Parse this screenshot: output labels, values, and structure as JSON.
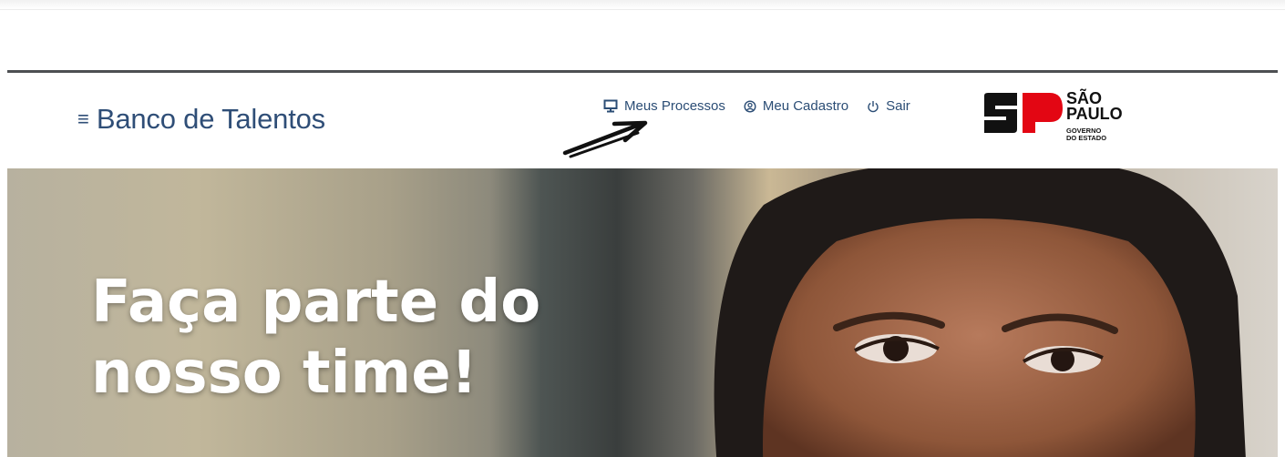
{
  "header": {
    "menu_icon": "hamburger-icon",
    "title": "Banco de Talentos",
    "nav": [
      {
        "label": "Meus Processos",
        "icon": "monitor-icon"
      },
      {
        "label": "Meu Cadastro",
        "icon": "user-circle-icon"
      },
      {
        "label": "Sair",
        "icon": "power-icon"
      }
    ],
    "logo": {
      "line1": "SÃO",
      "line2": "PAULO",
      "line3": "GOVERNO",
      "line4": "DO ESTADO"
    }
  },
  "hero": {
    "title": "Faça parte do nosso time!"
  },
  "colors": {
    "brand_blue": "#2f4e77",
    "logo_red": "#e30613",
    "frame_border": "#4d4f52"
  }
}
